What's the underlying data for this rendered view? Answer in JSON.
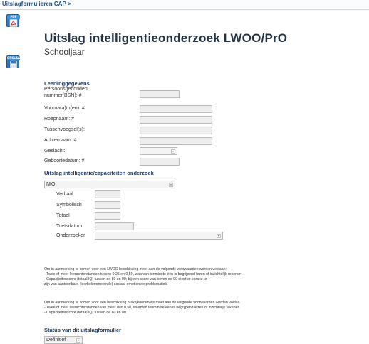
{
  "breadcrumb": "Uitslagformulieren CAP >",
  "sidebar": {
    "pdf": {
      "tag": "PDF"
    },
    "save": {
      "tag": "OPSLAAN"
    }
  },
  "header": {
    "title": "Uitslag intelligentieonderzoek LWOO/PrO",
    "subtitle": "Schooljaar"
  },
  "leerling": {
    "section_title": "Leerlinggegevens",
    "fields": {
      "bsn1": "Persoonsgebonden",
      "bsn2": "nummer(BSN): #",
      "voornamen": "Voorna(a)m(en): #",
      "roepnaam": "Roepnaam: #",
      "tussenvoegsel": "Tussenvoegsel(s):",
      "achternaam": "Achternaam: #",
      "geslacht": "Geslacht:",
      "geboortedatum": "Geboortedatum: #"
    }
  },
  "intelligentie": {
    "section_title": "Uitslag intelligentie/capaciteiten onderzoek",
    "test_value": "NIO",
    "rows": {
      "verbaal": "Verbaal",
      "symbolisch": "Symbolisch",
      "totaal": "Totaal",
      "toetsdatum": "Toetsdatum",
      "onderzoeker": "Onderzoeker"
    }
  },
  "notes": {
    "lwoo": [
      "Om in aanmerking te komen voor een LWOO beschikking moet aan de volgende voorwaarden worden voldaan:",
      "- Twee of meer leerachterstanden tussen 0,25 en 0,50, waarvan tenminste één is begrijpend lezen of inzichtelijk rekenen",
      "- Capaciteitenscore (totaal IQ) tussen de 80 en 90; bij een score van boven de 90 dient er sprake te",
      "zijn van aantoonbare (leerbelemmerende) sociaal-emotionele problematiek."
    ],
    "pro": [
      "Om in aanmerking te komen voor een beschikking praktijkonderwijs moet aan de volgende voorwaarden worden voldaa",
      "- Twee of meer leerachterstanden van meer dan 0,50, waarvan tenminste één is begrijpend lezen of inzichtelijk rekenen",
      "- Capaciteitenscore (totaal IQ) tussen de 60 en 80."
    ]
  },
  "status": {
    "section_title": "Status van dit uitslagformulier",
    "value": "Definitief"
  },
  "colors": {
    "accent": "#2f77c3",
    "title": "#243344",
    "section": "#1d3d66"
  }
}
